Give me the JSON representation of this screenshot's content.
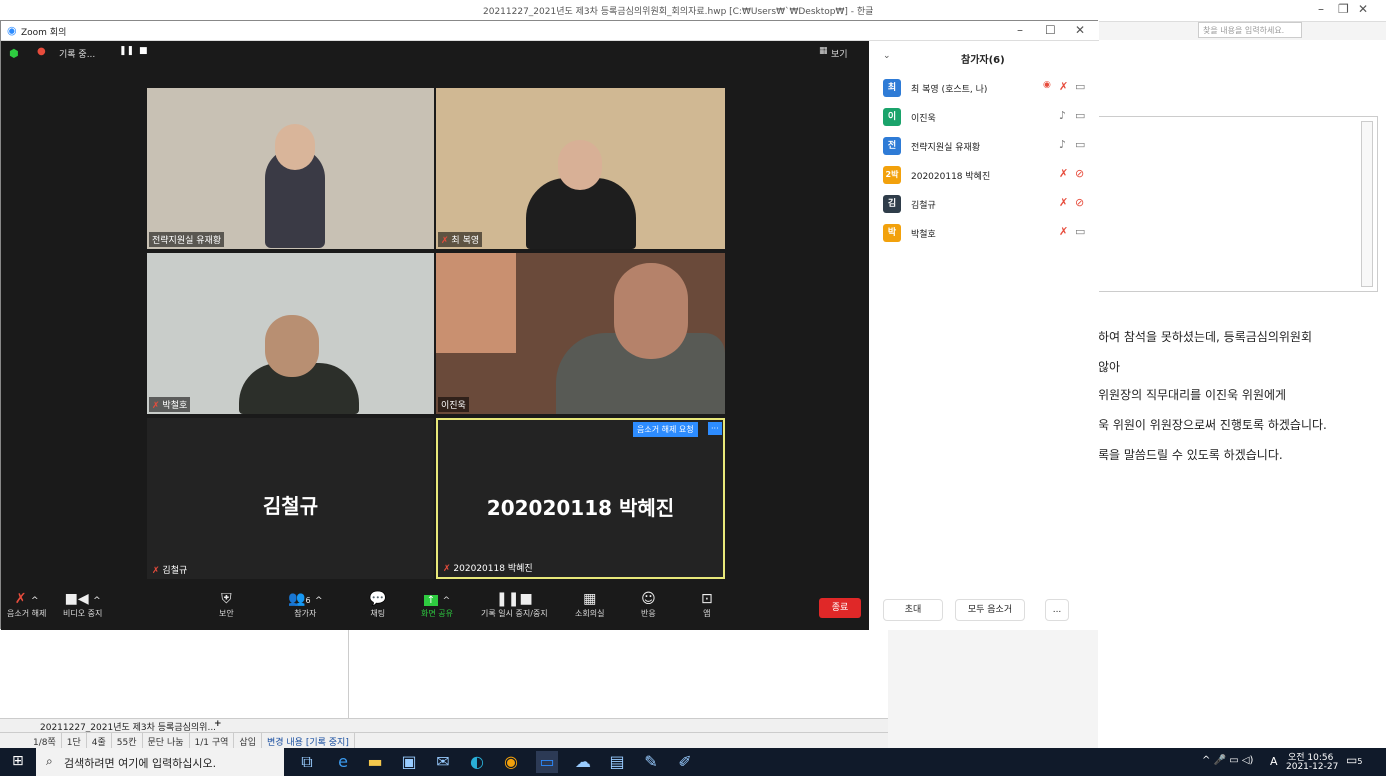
{
  "hwp": {
    "title": "20211227_2021년도 제3차 등록금심의위원회_회의자료.hwp [C:₩Users₩`₩Desktop₩] - 한글",
    "search_placeholder": "찾을 내용을 입력하세요.",
    "doc_lines": [
      "하여 참석을 못하셨는데, 등록금심의위원회",
      "않아",
      "위원장의 직무대리를 이진욱 위원에게",
      "욱 위원이 위원장으로써 진행토록 하겠습니다.",
      "록을 말씀드릴 수 있도록 하겠습니다."
    ],
    "tab_label": "20211227_2021년도 제3차 등록금심의위...",
    "tab_add": "+",
    "status": [
      "1/8쪽",
      "1단",
      "4줄",
      "55칸",
      "문단 나눔",
      "1/1 구역",
      "삽입",
      "변경 내용 [기록 중지]"
    ]
  },
  "zoom": {
    "window_title": "Zoom 회의",
    "recording_label": "기록 중...",
    "view_label": "보기",
    "tiles": [
      {
        "name": "전략지원실 유재황",
        "muted": false
      },
      {
        "name": "최 복영",
        "muted": true
      },
      {
        "name": "박철호",
        "muted": true
      },
      {
        "name": "이진욱",
        "muted": false
      },
      {
        "name": "김철규",
        "muted": true,
        "display": "김철규"
      },
      {
        "name": "202020118 박혜진",
        "muted": true,
        "display": "202020118 박혜진",
        "unmute_request": "음소거 해제 요청",
        "more": "···"
      }
    ],
    "toolbar": {
      "unmute": "음소거 해제",
      "video": "비디오 중지",
      "security": "보안",
      "participants": "참가자",
      "participants_count": "6",
      "chat": "채팅",
      "share": "화면 공유",
      "record": "기록 일시 중지/중지",
      "breakout": "소회의실",
      "reactions": "반응",
      "apps": "앱",
      "end": "종료"
    },
    "panel": {
      "title": "참가자(6)",
      "participants": [
        {
          "avatar": "최",
          "name": "최 복영 (호스트, 나)",
          "color": "#2e7bd6"
        },
        {
          "avatar": "이",
          "name": "이진욱",
          "color": "#1aa36b"
        },
        {
          "avatar": "전",
          "name": "전략지원실 유재황",
          "color": "#2e7bd6"
        },
        {
          "avatar": "2박",
          "name": "202020118 박혜진",
          "color": "#f2a10c"
        },
        {
          "avatar": "김",
          "name": "김철규",
          "color": "#2f3d4a"
        },
        {
          "avatar": "박",
          "name": "박철호",
          "color": "#f2a10c"
        }
      ],
      "invite": "초대",
      "mute_all": "모두 음소거",
      "more": "..."
    }
  },
  "taskbar": {
    "search_placeholder": "검색하려면 여기에 입력하십시오.",
    "time": "오전 10:56",
    "date": "2021-12-27",
    "lang": "A",
    "notifications": "5"
  }
}
